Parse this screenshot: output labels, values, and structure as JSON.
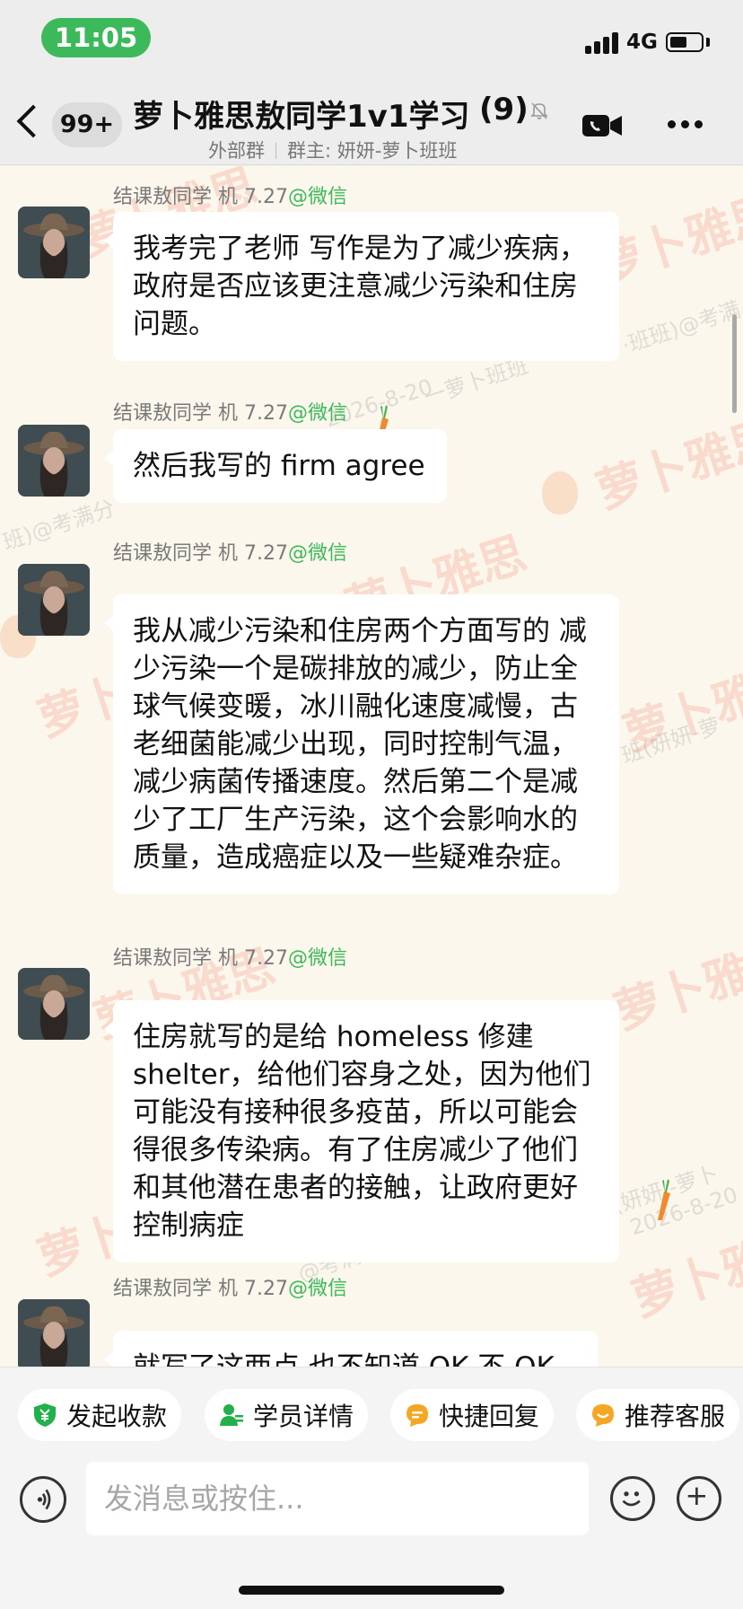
{
  "status_bar": {
    "time": "11:05",
    "network": "4G",
    "battery_level": 0.55
  },
  "header": {
    "back_badge": "99+",
    "title": "萝卜雅思敖同学1v1学习",
    "member_count": "(9)",
    "subtitle_tag": "外部群",
    "subtitle_owner": "群主: 妍妍-萝卜班班",
    "icons": [
      "back-arrow-icon",
      "mute-bell-icon",
      "video-call-icon",
      "more-icon"
    ]
  },
  "watermarks": {
    "brand": "萝卜雅思",
    "brand_short": "萝卜",
    "tag_1": "·班班)@考满",
    "tag_2": "一萝卜班班",
    "tag_3": "2026-8-20",
    "tag_4": "班)@考满分",
    "tag_5": "班(妍妍-萝",
    "tag_6": "(妍妍 -萝卜",
    "tag_7": "2026-8-20",
    "tag_8": "@考满分"
  },
  "messages": [
    {
      "sender": "结课敖同学 机 7.27",
      "source": "@微信",
      "text": "我考完了老师 写作是为了减少疾病，政府是否应该更注意减少污染和住房问题。"
    },
    {
      "sender": "结课敖同学 机 7.27",
      "source": "@微信",
      "text": "然后我写的 firm agree"
    },
    {
      "sender": "结课敖同学 机 7.27",
      "source": "@微信",
      "text": "我从减少污染和住房两个方面写的 减少污染一个是碳排放的减少，防止全球气候变暖，冰川融化速度减慢，古老细菌能减少出现，同时控制气温，减少病菌传播速度。然后第二个是减少了工厂生产污染，这个会影响水的质量，造成癌症以及一些疑难杂症。"
    },
    {
      "sender": "结课敖同学 机 7.27",
      "source": "@微信",
      "text": "住房就写的是给 homeless 修建 shelter，给他们容身之处，因为他们可能没有接种很多疫苗，所以可能会得很多传染病。有了住房减少了他们和其他潜在患者的接触，让政府更好控制病症"
    },
    {
      "sender": "结课敖同学 机 7.27",
      "source": "@微信",
      "text": "就写了这两点 也不知道 OK 不 OK"
    }
  ],
  "quick_actions": [
    {
      "label": "发起收款",
      "icon": "payment-shield-icon",
      "color": "#22b04b"
    },
    {
      "label": "学员详情",
      "icon": "student-info-icon",
      "color": "#22b04b"
    },
    {
      "label": "快捷回复",
      "icon": "quick-reply-icon",
      "color": "#f5a623"
    },
    {
      "label": "推荐客服",
      "icon": "recommend-service-icon",
      "color": "#f5a623"
    }
  ],
  "composer": {
    "placeholder": "发消息或按住...",
    "value": ""
  },
  "colors": {
    "wechat_green": "#3cb95a",
    "chat_background": "#fbf7ec",
    "bubble": "#ffffff"
  }
}
